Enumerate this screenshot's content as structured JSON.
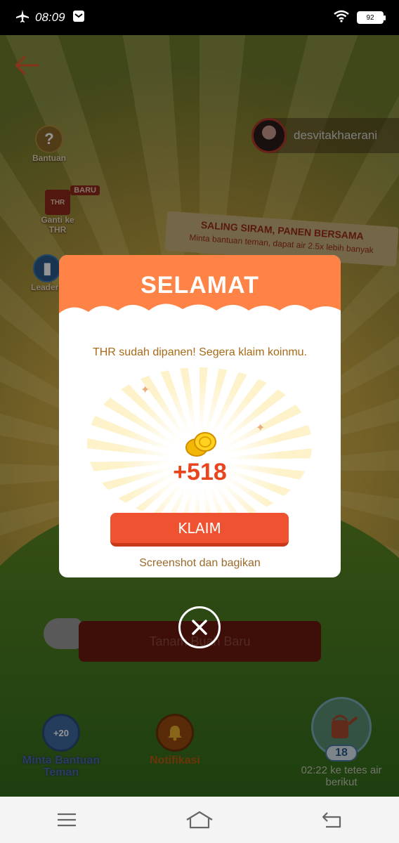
{
  "status_bar": {
    "time": "08:09",
    "battery": "92",
    "icons": [
      "airplane-icon",
      "notification-icon",
      "wifi-icon",
      "battery-icon"
    ]
  },
  "game": {
    "user": {
      "name": "desvitakhaerani"
    },
    "side_menu": {
      "help_label": "Bantuan",
      "thr_badge": "BARU",
      "thr_icon_text": "THR",
      "thr_label": "Ganti ke THR",
      "leaderboard_label": "Leaderb"
    },
    "banner": {
      "title": "SALING SIRAM, PANEN BERSAMA",
      "subtitle": "Minta bantuan teman, dapat air 2.5x lebih banyak"
    },
    "plant_button": "Tanam Buah Baru",
    "bottom": {
      "ask_help_badge": "+20",
      "ask_help_label": "Minta Bantuan Teman",
      "notification_label": "Notifikasi",
      "water_count": "18",
      "next_water_label": "02:22 ke tetes air berikut"
    }
  },
  "modal": {
    "title": "SELAMAT",
    "message": "THR sudah dipanen! Segera klaim koinmu.",
    "reward": "+518",
    "claim_button": "KLAIM",
    "share_link": "Screenshot dan bagikan"
  },
  "colors": {
    "accent_orange": "#ff8346",
    "claim_red": "#ef5230",
    "reward_red": "#e8451f"
  }
}
